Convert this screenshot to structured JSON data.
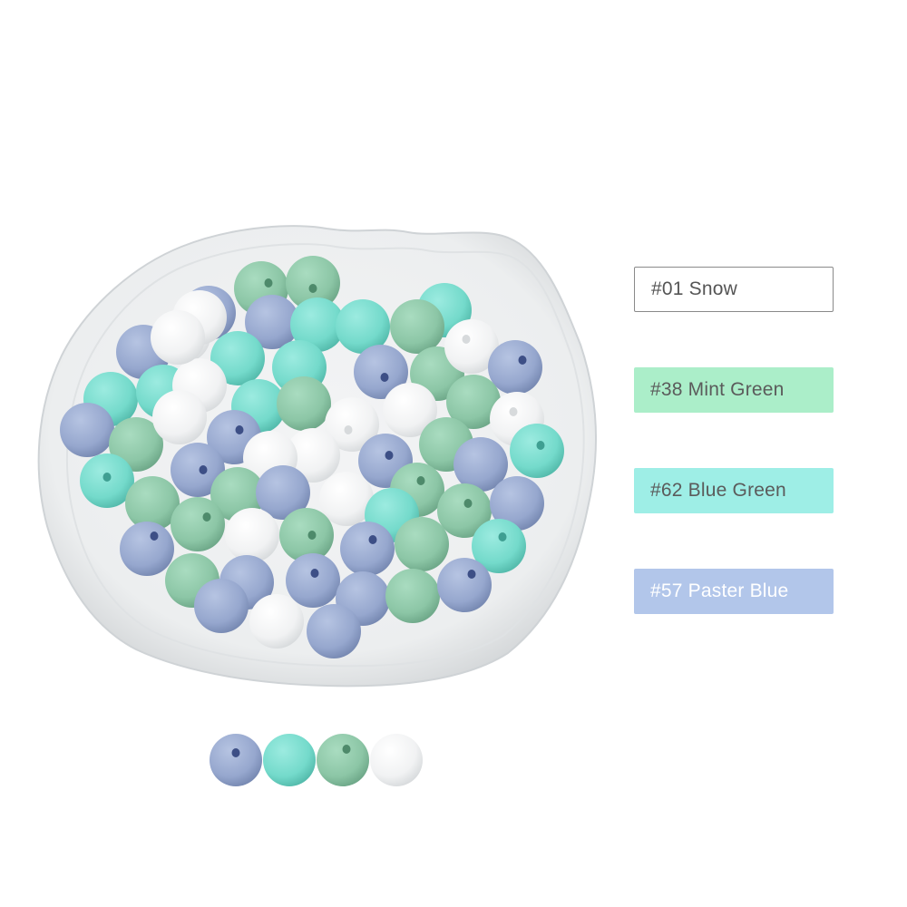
{
  "swatches": [
    {
      "label": "#01 Snow",
      "color": "#ffffff"
    },
    {
      "label": "#38 Mint Green",
      "color": "#abeec9"
    },
    {
      "label": "#62 Blue Green",
      "color": "#9eeee6"
    },
    {
      "label": "#57 Paster Blue",
      "color": "#b2c6ea"
    }
  ],
  "bead_colors": {
    "snow": "#f4f5f6",
    "mint_green": "#8fc9a9",
    "blue_green": "#77ddd0",
    "paster_blue": "#98a9cf"
  },
  "sample_row": [
    "paster_blue",
    "blue_green",
    "mint_green",
    "snow"
  ]
}
